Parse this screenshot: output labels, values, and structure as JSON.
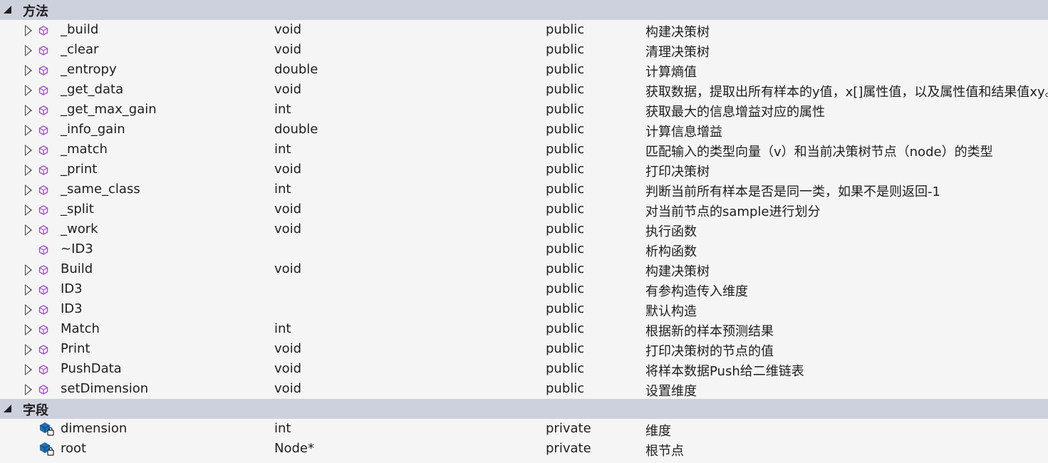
{
  "sections": {
    "methods": {
      "title": "方法",
      "rows": [
        {
          "name": "_build",
          "type": "void",
          "access": "public",
          "desc": "构建决策树",
          "expandable": true
        },
        {
          "name": "_clear",
          "type": "void",
          "access": "public",
          "desc": "清理决策树",
          "expandable": true
        },
        {
          "name": "_entropy",
          "type": "double",
          "access": "public",
          "desc": "计算熵值",
          "expandable": true
        },
        {
          "name": "_get_data",
          "type": "void",
          "access": "public",
          "desc": "获取数据，提取出所有样本的y值，x[]属性值，以及属性值和结果值xy。",
          "expandable": true
        },
        {
          "name": "_get_max_gain",
          "type": "int",
          "access": "public",
          "desc": "获取最大的信息增益对应的属性",
          "expandable": true
        },
        {
          "name": "_info_gain",
          "type": "double",
          "access": "public",
          "desc": "计算信息增益",
          "expandable": true
        },
        {
          "name": "_match",
          "type": "int",
          "access": "public",
          "desc": "匹配输入的类型向量（v）和当前决策树节点（node）的类型",
          "expandable": true
        },
        {
          "name": "_print",
          "type": "void",
          "access": "public",
          "desc": "打印决策树",
          "expandable": true
        },
        {
          "name": "_same_class",
          "type": "int",
          "access": "public",
          "desc": "判断当前所有样本是否是同一类，如果不是则返回-1",
          "expandable": true
        },
        {
          "name": "_split",
          "type": "void",
          "access": "public",
          "desc": "对当前节点的sample进行划分",
          "expandable": true
        },
        {
          "name": "_work",
          "type": "void",
          "access": "public",
          "desc": "执行函数",
          "expandable": true
        },
        {
          "name": "~ID3",
          "type": "",
          "access": "public",
          "desc": "析构函数",
          "expandable": false
        },
        {
          "name": "Build",
          "type": "void",
          "access": "public",
          "desc": "构建决策树",
          "expandable": true
        },
        {
          "name": "ID3",
          "type": "",
          "access": "public",
          "desc": "有参构造传入维度",
          "expandable": true
        },
        {
          "name": "ID3",
          "type": "",
          "access": "public",
          "desc": "默认构造",
          "expandable": true
        },
        {
          "name": "Match",
          "type": "int",
          "access": "public",
          "desc": "根据新的样本预测结果",
          "expandable": true
        },
        {
          "name": "Print",
          "type": "void",
          "access": "public",
          "desc": "打印决策树的节点的值",
          "expandable": true
        },
        {
          "name": "PushData",
          "type": "void",
          "access": "public",
          "desc": "将样本数据Push给二维链表",
          "expandable": true
        },
        {
          "name": "setDimension",
          "type": "void",
          "access": "public",
          "desc": "设置维度",
          "expandable": true
        }
      ]
    },
    "fields": {
      "title": "字段",
      "rows": [
        {
          "name": "dimension",
          "type": "int",
          "access": "private",
          "desc": "维度"
        },
        {
          "name": "root",
          "type": "Node*",
          "access": "private",
          "desc": "根节点"
        }
      ]
    }
  },
  "icons": {
    "method": "method-cube-icon",
    "field": "private-field-icon",
    "expander": "expand-arrow-icon",
    "collapse": "collapse-arrow-icon"
  },
  "colors": {
    "header_bg": "#cdd0dd",
    "background": "#f5f5f5",
    "method_icon": "#a44ec8",
    "field_icon": "#1f6fb2"
  }
}
